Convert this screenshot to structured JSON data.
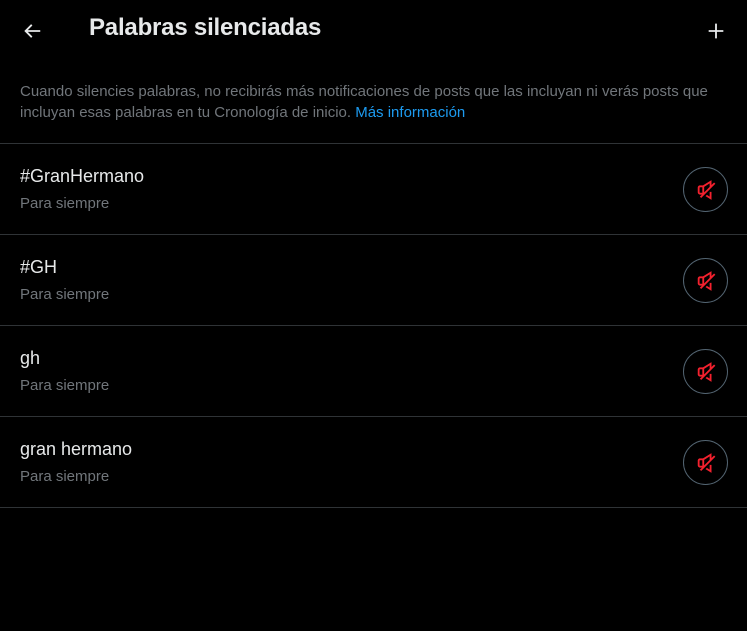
{
  "header": {
    "back_icon": "arrow-left-icon",
    "title": "Palabras silenciadas",
    "add_icon": "plus-icon"
  },
  "description": {
    "text": "Cuando silencies palabras, no recibirás más notificaciones de posts que las incluyan ni verás posts que incluyan esas palabras en tu Cronología de inicio.",
    "link": "Más información"
  },
  "muted_words": [
    {
      "word": "#GranHermano",
      "duration": "Para siempre"
    },
    {
      "word": "#GH",
      "duration": "Para siempre"
    },
    {
      "word": "gh",
      "duration": "Para siempre"
    },
    {
      "word": "gran hermano",
      "duration": "Para siempre"
    }
  ],
  "unmute_icon": "muted-speaker-icon",
  "colors": {
    "background": "#000000",
    "primary_text": "#e7e9ea",
    "secondary_text": "#71767b",
    "link": "#1d9bf0",
    "divider": "#2f3336",
    "muted_icon": "#f4212e"
  }
}
